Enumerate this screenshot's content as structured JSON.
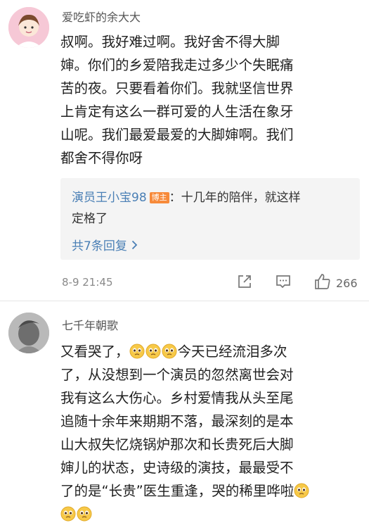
{
  "comments": [
    {
      "username": "爱吃虾的余大大",
      "body_lines": [
        "叔啊。我好难过啊。我好舍不得大脚",
        "婶。你们的乡爱陪我走过多少个失眠痛",
        "苦的夜。只要看着你们。我就坚信世界",
        "上肯定有这么一群可爱的人生活在象牙",
        "山呢。我们最爱最爱的大脚婶啊。我们",
        "都舍不得你呀"
      ],
      "reply": {
        "author": "演员王小宝98",
        "badge": "博主",
        "text_line1": "：十几年的陪伴，就这样",
        "text_line2": "定格了",
        "more": "共7条回复"
      },
      "timestamp": "8-9 21:45",
      "like_count": "266"
    },
    {
      "username": "七千年朝歌",
      "body": {
        "l1_a": "又看哭了，",
        "l1_b": "今天已经流泪多次",
        "l2": "了，从没想到一个演员的忽然离世会对",
        "l3": "我有这么大伤心。乡村爱情我从头至尾",
        "l4": "追随十余年来期期不落，最深刻的是本",
        "l5": "山大叔失忆烧锅炉那次和长贵死后大脚",
        "l6": "婶儿的状态，史诗级的演技，最最受不",
        "l7": "了的是“长贵”医生重逢，哭的稀里哗啦"
      }
    }
  ],
  "icons": {
    "share": "share-icon",
    "comment": "comment-icon",
    "like": "thumbs-up-icon",
    "emoji": "pleading-face-emoji"
  },
  "colors": {
    "link_blue": "#4a7fb5",
    "badge_orange": "#f78a3a",
    "reply_bg": "#f4f4f4",
    "muted_text": "#8a8a8a"
  }
}
